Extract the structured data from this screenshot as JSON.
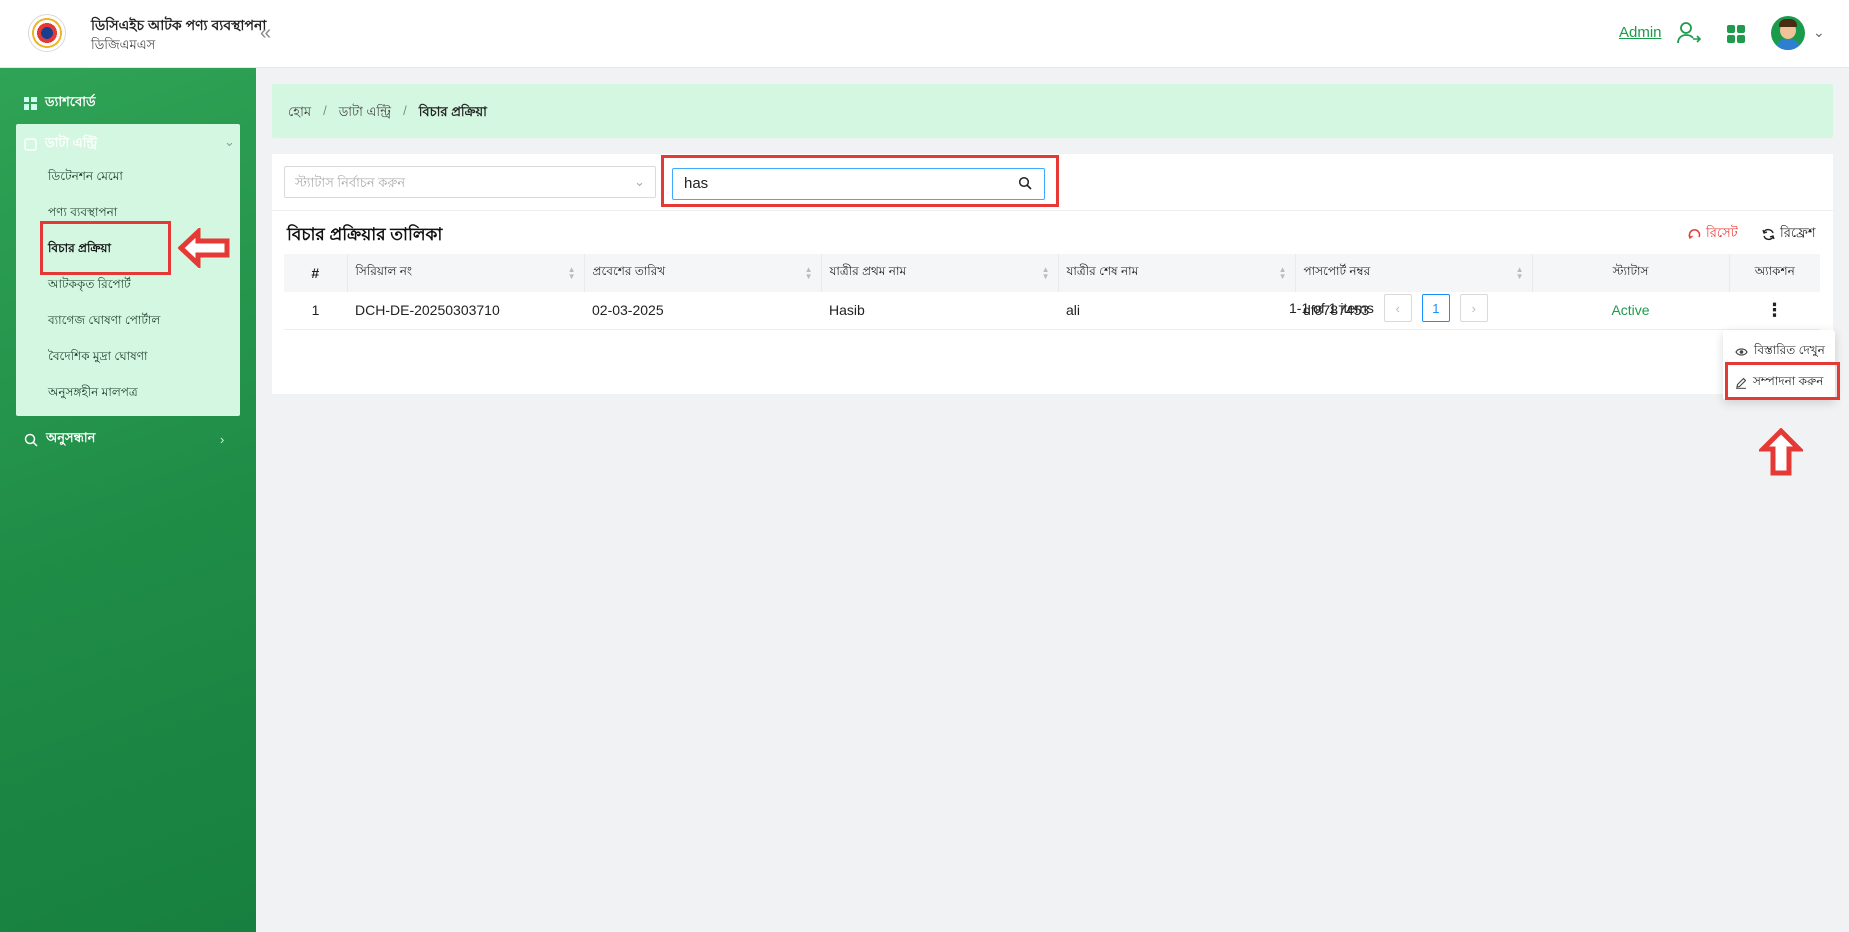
{
  "header": {
    "app_title": "ডিসিএইচ আটক পণ্য ব্যবস্থাপনা",
    "app_subtitle": "ডিজিএমএস",
    "admin_label": "Admin"
  },
  "sidebar": {
    "dashboard": "ড্যাশবোর্ড",
    "data_entry": "ডাটা এন্ট্রি",
    "items": [
      "ডিটেনশন মেমো",
      "পণ্য ব্যবস্থাপনা",
      "বিচার প্রক্রিয়া",
      "আটককৃত রিপোর্ট",
      "ব্যাগেজ ঘোষণা পোর্টাল",
      "বৈদেশিক মুদ্রা ঘোষণা",
      "অনুসঙ্গহীন মালপত্র"
    ],
    "search": "অনুসন্ধান"
  },
  "breadcrumb": [
    "হোম",
    "ডাটা এন্ট্রি",
    "বিচার প্রক্রিয়া"
  ],
  "filters": {
    "status_placeholder": "স্ট্যাটাস নির্বাচন করুন",
    "search_value": "has"
  },
  "table": {
    "title": "বিচার প্রক্রিয়ার তালিকা",
    "reset_label": "রিসেট",
    "refresh_label": "রিফ্রেশ",
    "columns": [
      "#",
      "সিরিয়াল নং",
      "প্রবেশের তারিখ",
      "যাত্রীর প্রথম নাম",
      "যাত্রীর শেষ নাম",
      "পাসপোর্ট নম্বর",
      "স্ট্যাটাস",
      "অ্যাকশন"
    ],
    "rows": [
      {
        "index": "1",
        "serial": "DCH-DE-20250303710",
        "entry_date": "02-03-2025",
        "first_name": "Hasib",
        "last_name": "ali",
        "passport": "df8787453",
        "status": "Active"
      }
    ]
  },
  "pagination": {
    "summary": "1-1 of 1 items",
    "current_page": "1"
  },
  "action_menu": {
    "view": "বিস্তারিত দেখুন",
    "edit": "সম্পাদনা করুন"
  },
  "colors": {
    "brand_green": "#1e9b4b",
    "breadcrumb_bg": "#d3f7e0",
    "annotation_red": "#e53935"
  }
}
